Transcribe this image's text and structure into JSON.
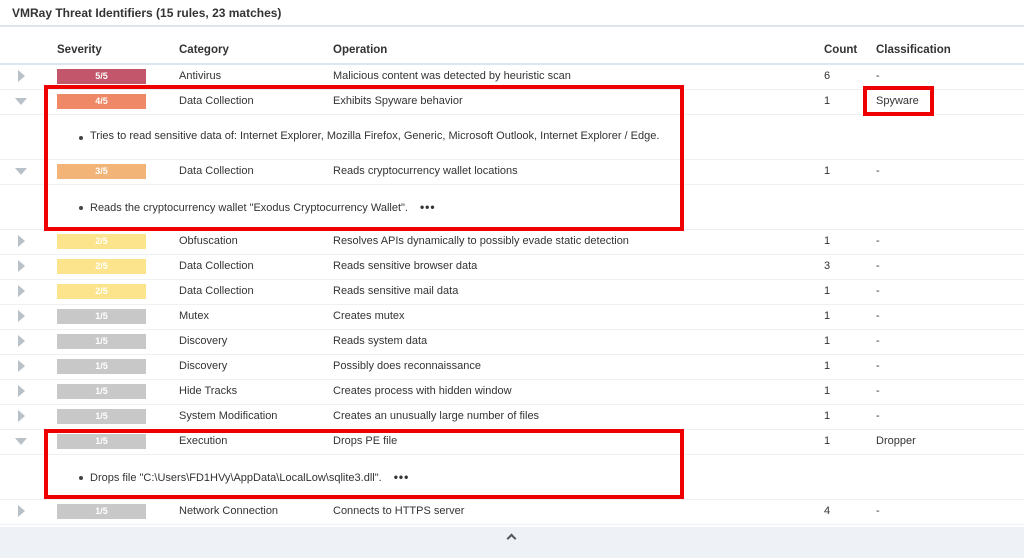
{
  "title": "VMRay Threat Identifiers (15 rules, 23 matches)",
  "columns": {
    "severity": "Severity",
    "category": "Category",
    "operation": "Operation",
    "count": "Count",
    "classification": "Classification"
  },
  "colors": {
    "sev5": "#c3566a",
    "sev4": "#ef8866",
    "sev3": "#f3b478",
    "sev2": "#fbe48b",
    "sev1": "#c8c8c8",
    "highlight": "#ee0000"
  },
  "icons": {
    "collapsed": "triangle-right-icon",
    "expanded": "triangle-down-icon",
    "collapse_all": "chevron-up-icon"
  },
  "rows": [
    {
      "severity": "5/5",
      "category": "Antivirus",
      "operation": "Malicious content was detected by heuristic scan",
      "count": "6",
      "classification": "-",
      "expanded": false
    },
    {
      "severity": "4/5",
      "category": "Data Collection",
      "operation": "Exhibits Spyware behavior",
      "count": "1",
      "classification": "Spyware",
      "expanded": true,
      "detail": "Tries to read sensitive data of: Internet Explorer, Mozilla Firefox, Generic, Microsoft Outlook, Internet Explorer / Edge."
    },
    {
      "severity": "3/5",
      "category": "Data Collection",
      "operation": "Reads cryptocurrency wallet locations",
      "count": "1",
      "classification": "-",
      "expanded": true,
      "detail": "Reads the cryptocurrency wallet \"Exodus Cryptocurrency Wallet\".",
      "more": "•••"
    },
    {
      "severity": "2/5",
      "category": "Obfuscation",
      "operation": "Resolves APIs dynamically to possibly evade static detection",
      "count": "1",
      "classification": "-",
      "expanded": false
    },
    {
      "severity": "2/5",
      "category": "Data Collection",
      "operation": "Reads sensitive browser data",
      "count": "3",
      "classification": "-",
      "expanded": false
    },
    {
      "severity": "2/5",
      "category": "Data Collection",
      "operation": "Reads sensitive mail data",
      "count": "1",
      "classification": "-",
      "expanded": false
    },
    {
      "severity": "1/5",
      "category": "Mutex",
      "operation": "Creates mutex",
      "count": "1",
      "classification": "-",
      "expanded": false
    },
    {
      "severity": "1/5",
      "category": "Discovery",
      "operation": "Reads system data",
      "count": "1",
      "classification": "-",
      "expanded": false
    },
    {
      "severity": "1/5",
      "category": "Discovery",
      "operation": "Possibly does reconnaissance",
      "count": "1",
      "classification": "-",
      "expanded": false
    },
    {
      "severity": "1/5",
      "category": "Hide Tracks",
      "operation": "Creates process with hidden window",
      "count": "1",
      "classification": "-",
      "expanded": false
    },
    {
      "severity": "1/5",
      "category": "System Modification",
      "operation": "Creates an unusually large number of files",
      "count": "1",
      "classification": "-",
      "expanded": false
    },
    {
      "severity": "1/5",
      "category": "Execution",
      "operation": "Drops PE file",
      "count": "1",
      "classification": "Dropper",
      "expanded": true,
      "detail": "Drops file \"C:\\Users\\FD1HVy\\AppData\\LocalLow\\sqlite3.dll\".",
      "more": "•••"
    },
    {
      "severity": "1/5",
      "category": "Network Connection",
      "operation": "Connects to HTTPS server",
      "count": "4",
      "classification": "-",
      "expanded": false
    }
  ]
}
